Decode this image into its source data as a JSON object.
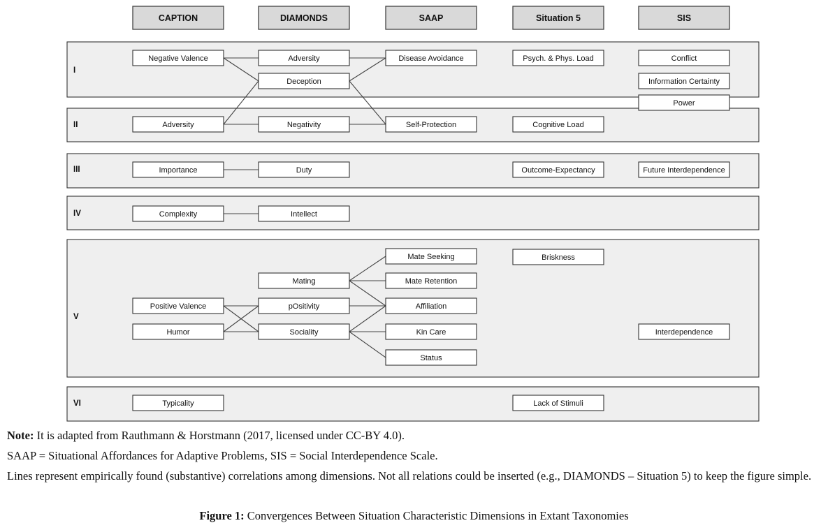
{
  "columns": [
    {
      "id": "caption",
      "label": "CAPTION"
    },
    {
      "id": "diamonds",
      "label": "DIAMONDS"
    },
    {
      "id": "saap",
      "label": "SAAP"
    },
    {
      "id": "sit5",
      "label": "Situation 5"
    },
    {
      "id": "sis",
      "label": "SIS"
    }
  ],
  "rows": [
    {
      "id": "I",
      "label": "I"
    },
    {
      "id": "II",
      "label": "II"
    },
    {
      "id": "III",
      "label": "III"
    },
    {
      "id": "IV",
      "label": "IV"
    },
    {
      "id": "V",
      "label": "V"
    },
    {
      "id": "VI",
      "label": "VI"
    }
  ],
  "nodes": [
    {
      "id": "neg_val",
      "label": "Negative Valence",
      "col": "caption",
      "row": "I",
      "slot": 0
    },
    {
      "id": "adv_d",
      "label": "Adversity",
      "col": "diamonds",
      "row": "I",
      "slot": 0
    },
    {
      "id": "decep",
      "label": "Deception",
      "col": "diamonds",
      "row": "I",
      "slot": 1
    },
    {
      "id": "disease",
      "label": "Disease Avoidance",
      "col": "saap",
      "row": "I",
      "slot": 0
    },
    {
      "id": "psych",
      "label": "Psych. & Phys. Load",
      "col": "sit5",
      "row": "I",
      "slot": 0
    },
    {
      "id": "conflict",
      "label": "Conflict",
      "col": "sis",
      "row": "I",
      "slot": 0
    },
    {
      "id": "info",
      "label": "Information Certainty",
      "col": "sis",
      "row": "I",
      "slot": 1
    },
    {
      "id": "power",
      "label": "Power",
      "col": "sis",
      "row": "I",
      "slot": 2
    },
    {
      "id": "adv_c",
      "label": "Adversity",
      "col": "caption",
      "row": "II",
      "slot": 0
    },
    {
      "id": "negativity",
      "label": "Negativity",
      "col": "diamonds",
      "row": "II",
      "slot": 0
    },
    {
      "id": "selfprot",
      "label": "Self-Protection",
      "col": "saap",
      "row": "II",
      "slot": 0
    },
    {
      "id": "cogload",
      "label": "Cognitive Load",
      "col": "sit5",
      "row": "II",
      "slot": 0
    },
    {
      "id": "importance",
      "label": "Importance",
      "col": "caption",
      "row": "III",
      "slot": 0
    },
    {
      "id": "duty",
      "label": "Duty",
      "col": "diamonds",
      "row": "III",
      "slot": 0
    },
    {
      "id": "outcome",
      "label": "Outcome-Expectancy",
      "col": "sit5",
      "row": "III",
      "slot": 0
    },
    {
      "id": "future",
      "label": "Future Interdependence",
      "col": "sis",
      "row": "III",
      "slot": 0
    },
    {
      "id": "complexity",
      "label": "Complexity",
      "col": "caption",
      "row": "IV",
      "slot": 0
    },
    {
      "id": "intellect",
      "label": "Intellect",
      "col": "diamonds",
      "row": "IV",
      "slot": 0
    },
    {
      "id": "mateseek",
      "label": "Mate Seeking",
      "col": "saap",
      "row": "V",
      "slot": 0
    },
    {
      "id": "briskness",
      "label": "Briskness",
      "col": "sit5",
      "row": "V",
      "slot": 0
    },
    {
      "id": "mating",
      "label": "Mating",
      "col": "diamonds",
      "row": "V",
      "slot": 1
    },
    {
      "id": "materet",
      "label": "Mate Retention",
      "col": "saap",
      "row": "V",
      "slot": 1
    },
    {
      "id": "posval",
      "label": "Positive Valence",
      "col": "caption",
      "row": "V",
      "slot": 2
    },
    {
      "id": "positivity",
      "label": "pOsitivity",
      "col": "diamonds",
      "row": "V",
      "slot": 2
    },
    {
      "id": "affil",
      "label": "Affiliation",
      "col": "saap",
      "row": "V",
      "slot": 2
    },
    {
      "id": "humor",
      "label": "Humor",
      "col": "caption",
      "row": "V",
      "slot": 3
    },
    {
      "id": "sociality",
      "label": "Sociality",
      "col": "diamonds",
      "row": "V",
      "slot": 3
    },
    {
      "id": "kincare",
      "label": "Kin Care",
      "col": "saap",
      "row": "V",
      "slot": 3
    },
    {
      "id": "interdep",
      "label": "Interdependence",
      "col": "sis",
      "row": "V",
      "slot": 3
    },
    {
      "id": "status",
      "label": "Status",
      "col": "saap",
      "row": "V",
      "slot": 4
    },
    {
      "id": "typicality",
      "label": "Typicality",
      "col": "caption",
      "row": "VI",
      "slot": 0
    },
    {
      "id": "lackstim",
      "label": "Lack of Stimuli",
      "col": "sit5",
      "row": "VI",
      "slot": 0
    }
  ],
  "edges": [
    [
      "neg_val",
      "adv_d"
    ],
    [
      "neg_val",
      "decep"
    ],
    [
      "adv_d",
      "disease"
    ],
    [
      "decep",
      "disease"
    ],
    [
      "decep",
      "selfprot"
    ],
    [
      "adv_c",
      "decep"
    ],
    [
      "adv_c",
      "negativity"
    ],
    [
      "negativity",
      "selfprot"
    ],
    [
      "importance",
      "duty"
    ],
    [
      "complexity",
      "intellect"
    ],
    [
      "mating",
      "mateseek"
    ],
    [
      "mating",
      "materet"
    ],
    [
      "mating",
      "affil"
    ],
    [
      "posval",
      "positivity"
    ],
    [
      "posval",
      "sociality"
    ],
    [
      "humor",
      "positivity"
    ],
    [
      "humor",
      "sociality"
    ],
    [
      "positivity",
      "affil"
    ],
    [
      "sociality",
      "affil"
    ],
    [
      "sociality",
      "kincare"
    ],
    [
      "sociality",
      "status"
    ]
  ],
  "notes": {
    "note_label": "Note:",
    "note_text": " It is adapted from Rauthmann & Horstmann (2017, licensed under CC-BY 4.0).",
    "abbrev": "SAAP = Situational Affordances for Adaptive Problems, SIS = Social Interdependence Scale.",
    "lines": "Lines represent empirically found (substantive) correlations among dimensions. Not all relations could be inserted (e.g., DIAMONDS – Situation 5) to keep the figure simple."
  },
  "figure": {
    "label": "Figure 1:",
    "title": " Convergences Between Situation Characteristic Dimensions in Extant Taxonomies"
  }
}
